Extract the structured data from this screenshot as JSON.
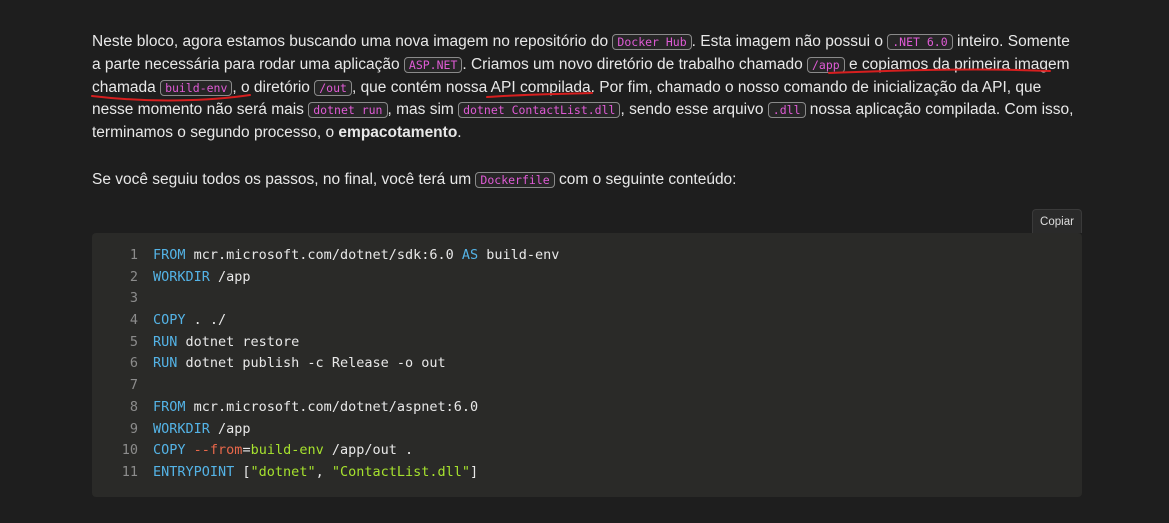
{
  "paragraph1": {
    "t1": "Neste bloco, agora estamos buscando uma nova imagem no repositório do ",
    "c1": "Docker Hub",
    "t2": ". Esta imagem não possui o ",
    "c2": ".NET 6.0",
    "t3": " inteiro. Somente a parte necessária para rodar uma aplicação ",
    "c3": "ASP.NET",
    "t4": ". Criamos um novo diretório de trabalho chamado ",
    "c4": "/app",
    "t5": " e copiamos da primeira imagem chamada ",
    "c5": "build-env",
    "t6": ", o diretório ",
    "c6": "/out",
    "t7": ", que contém nossa API compilada. Por fim, chamado o nosso comando de inicialização da API, que nesse momento não será mais ",
    "c7": "dotnet run",
    "t8": ", mas sim ",
    "c8": "dotnet ContactList.dll",
    "t9": ", sendo esse arquivo ",
    "c9": ".dll",
    "t10": " nossa aplicação compilada. Com isso, terminamos o segundo processo, o ",
    "strong": "empacotamento",
    "t11": "."
  },
  "paragraph2": {
    "t1": "Se você seguiu todos os passos, no final, você terá um ",
    "c1": "Dockerfile",
    "t2": " com o seguinte conteúdo:"
  },
  "copy_button": "Copiar",
  "code": {
    "line_numbers": [
      "1",
      "2",
      "3",
      "4",
      "5",
      "6",
      "7",
      "8",
      "9",
      "10",
      "11"
    ],
    "l1": {
      "kw1": "FROM",
      "t1": " mcr.microsoft.com/dotnet/sdk:6.0 ",
      "kw2": "AS",
      "t2": " build-env"
    },
    "l2": {
      "kw": "WORKDIR",
      "t": " /app"
    },
    "l3": "",
    "l4": {
      "kw": "COPY",
      "t": " . ./"
    },
    "l5": {
      "kw": "RUN",
      "t": " dotnet restore"
    },
    "l6": {
      "kw": "RUN",
      "t": " dotnet publish -c Release -o out"
    },
    "l7": "",
    "l8": {
      "kw": "FROM",
      "t": " mcr.microsoft.com/dotnet/aspnet:6.0"
    },
    "l9": {
      "kw": "WORKDIR",
      "t": " /app"
    },
    "l10": {
      "kw": "COPY",
      "sp": " ",
      "op": "--from",
      "eq": "=",
      "hl": "build-env",
      "t": " /app/out ."
    },
    "l11": {
      "kw": "ENTRYPOINT",
      "t1": " [",
      "s1": "\"dotnet\"",
      "t2": ", ",
      "s2": "\"ContactList.dll\"",
      "t3": "]"
    }
  },
  "colors": {
    "background": "#1e1e1e",
    "code_background": "#2a2a28",
    "inline_code": "#e05bd6",
    "keyword": "#54b3e6",
    "string": "#a6e22e",
    "annotation": "#d61f1f"
  }
}
